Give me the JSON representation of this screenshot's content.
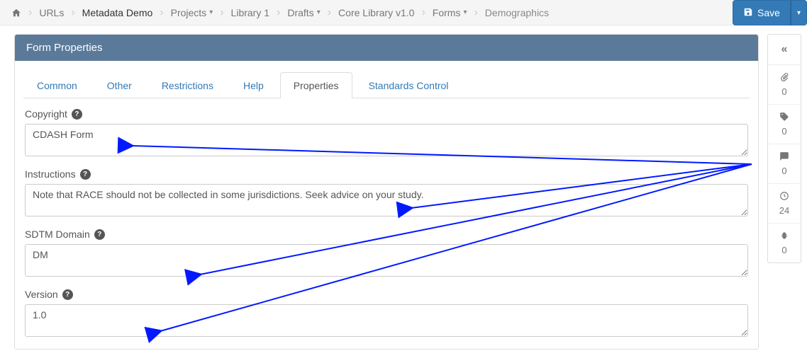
{
  "breadcrumb": {
    "urls": "URLs",
    "demo": "Metadata Demo",
    "projects": "Projects",
    "library": "Library 1",
    "drafts": "Drafts",
    "core": "Core Library v1.0",
    "forms": "Forms",
    "current": "Demographics"
  },
  "save_label": "Save",
  "panel_title": "Form Properties",
  "tabs": {
    "common": "Common",
    "other": "Other",
    "restrictions": "Restrictions",
    "help": "Help",
    "properties": "Properties",
    "standards": "Standards Control"
  },
  "fields": {
    "copyright_label": "Copyright",
    "copyright_value": "CDASH Form",
    "instructions_label": "Instructions",
    "instructions_value": "Note that RACE should not be collected in some jurisdictions. Seek advice on your study.",
    "sdtm_label": "SDTM Domain",
    "sdtm_value": "DM",
    "version_label": "Version",
    "version_value": "1.0"
  },
  "sidebar": {
    "a": "0",
    "b": "0",
    "c": "0",
    "d": "24",
    "e": "0"
  }
}
